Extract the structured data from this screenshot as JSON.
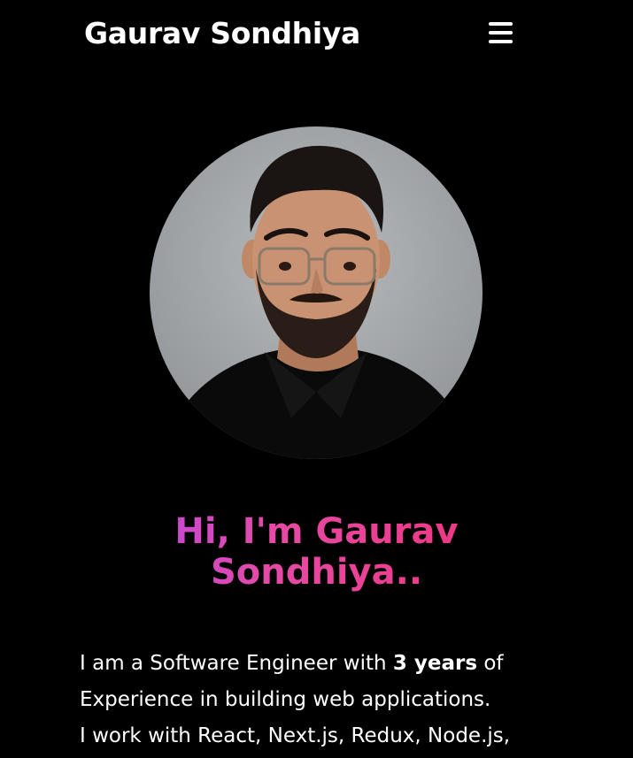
{
  "navbar": {
    "brand": "Gaurav Sondhiya",
    "menu_icon": "hamburger-menu-icon"
  },
  "hero": {
    "photo_alt": "Gaurav Sondhiya",
    "title_line1": "Hi, I'm Gaurav",
    "title_line2": "Sondhiya..",
    "bio_part1": "I am a Software Engineer with ",
    "bio_bold": "3 years",
    "bio_part2": " of",
    "bio_line2": "Experience in building web applications.",
    "bio_line3": "I work with React, Next.js, Redux, Node.js,"
  },
  "colors": {
    "background": "#000000",
    "text": "#ffffff",
    "gradient_start": "#b847e8",
    "gradient_end": "#f0327a"
  }
}
